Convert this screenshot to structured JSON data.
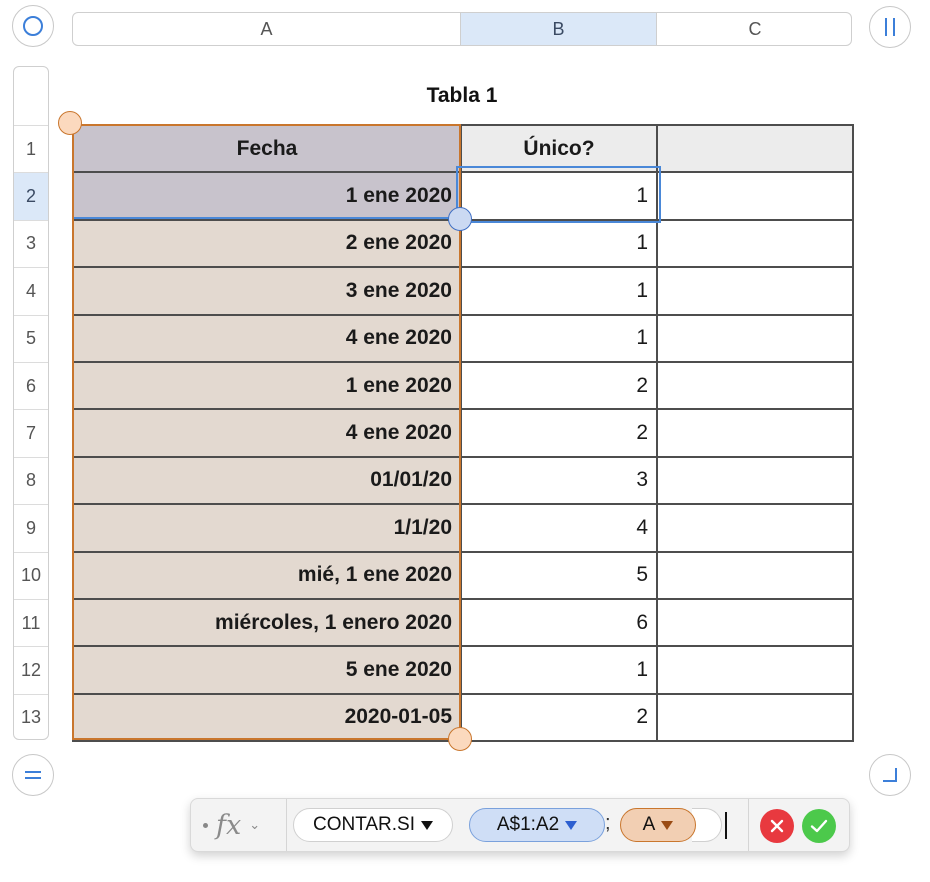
{
  "columns": [
    {
      "label": "A",
      "selected": false
    },
    {
      "label": "B",
      "selected": true
    },
    {
      "label": "C",
      "selected": false
    }
  ],
  "rows": [
    "1",
    "2",
    "3",
    "4",
    "5",
    "6",
    "7",
    "8",
    "9",
    "10",
    "11",
    "12",
    "13"
  ],
  "selected_row": "2",
  "table": {
    "title": "Tabla 1",
    "header": [
      "Fecha",
      "Único?",
      ""
    ],
    "body": [
      [
        "1 ene 2020",
        "1"
      ],
      [
        "2 ene 2020",
        "1"
      ],
      [
        "3 ene 2020",
        "1"
      ],
      [
        "4 ene 2020",
        "1"
      ],
      [
        "1 ene 2020",
        "2"
      ],
      [
        "4 ene 2020",
        "2"
      ],
      [
        "01/01/20",
        "3"
      ],
      [
        "1/1/20",
        "4"
      ],
      [
        "mié, 1 ene 2020",
        "5"
      ],
      [
        "miércoles, 1 enero 2020",
        "6"
      ],
      [
        "5 ene 2020",
        "1"
      ],
      [
        "2020-01-05",
        "2"
      ]
    ]
  },
  "formula_bar": {
    "function_name": "CONTAR.SI",
    "range_token": "A$1:A2",
    "separator": ";",
    "reference_token": "A"
  },
  "icons": {
    "select_table": "circle-icon",
    "freeze_columns": "pause-bars-icon",
    "freeze_rows": "equals-icon",
    "resize": "corner-resize-icon",
    "cancel": "x-icon",
    "accept": "checkmark-icon"
  },
  "colors": {
    "selection_blue": "#4a88d8",
    "reference_orange": "#c9762d",
    "header_fill": "#ececec",
    "column_a_fill": "#e3d9d0"
  }
}
